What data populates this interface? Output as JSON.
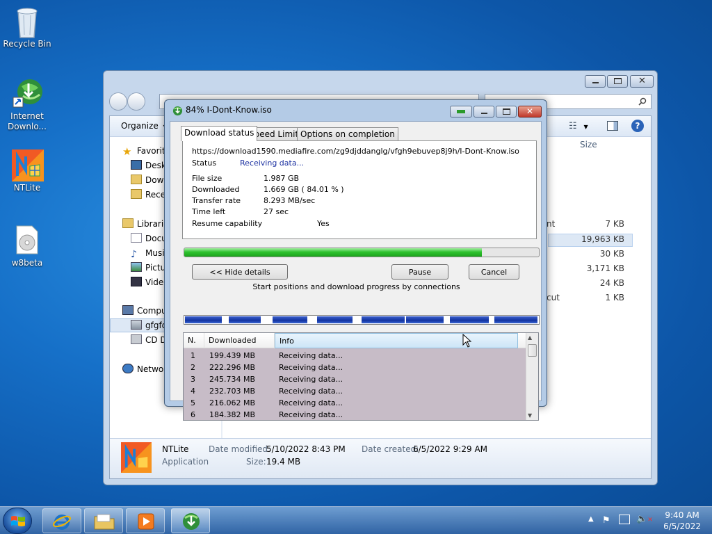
{
  "desktop": {
    "icons": [
      {
        "label": "Recycle Bin"
      },
      {
        "label": "Internet Downlo..."
      },
      {
        "label": "NTLite"
      },
      {
        "label": "w8beta"
      }
    ]
  },
  "explorer": {
    "organize_label": "Organize",
    "size_header": "Size",
    "nav": {
      "favorites": "Favorite",
      "desktop": "Deskt",
      "downloads": "Down",
      "recent": "Recen",
      "libraries": "Librarie",
      "documents": "Docu",
      "music": "Music",
      "pictures": "Pictur",
      "videos": "Video",
      "computer": "Compu",
      "drive": "gfgfd",
      "cd_drive": "CD Dr",
      "network": "Networ"
    },
    "size_rows": [
      {
        "type": "nt",
        "size": "7 KB"
      },
      {
        "type": "",
        "size": "19,963 KB"
      },
      {
        "type": "",
        "size": "30 KB"
      },
      {
        "type": "",
        "size": "3,171 KB"
      },
      {
        "type": "",
        "size": "24 KB"
      },
      {
        "type": "cut",
        "size": "1 KB"
      }
    ],
    "details": {
      "name": "NTLite",
      "kind": "Application",
      "date_modified_label": "Date modified:",
      "date_modified": "5/10/2022 8:43 PM",
      "size_label": "Size:",
      "size": "19.4 MB",
      "date_created_label": "Date created:",
      "date_created": "6/5/2022 9:29 AM"
    }
  },
  "idm": {
    "title": "84% I-Dont-Know.iso",
    "tabs": [
      "Download status",
      "Speed Limiter",
      "Options on completion"
    ],
    "url": "https://download1590.mediafire.com/zg9djddanglg/vfgh9ebuvep8j9h/I-Dont-Know.iso",
    "status_label": "Status",
    "status_value": "Receiving data...",
    "file_size_label": "File size",
    "file_size": "1.987  GB",
    "downloaded_label": "Downloaded",
    "downloaded": "1.669  GB  ( 84.01 % )",
    "transfer_rate_label": "Transfer rate",
    "transfer_rate": "8.293  MB/sec",
    "time_left_label": "Time left",
    "time_left": "27 sec",
    "resume_label": "Resume capability",
    "resume_value": "Yes",
    "progress_fraction": 0.8401,
    "hide_details_label": "<< Hide details",
    "pause_label": "Pause",
    "cancel_label": "Cancel",
    "connections_caption": "Start positions and download progress by connections",
    "columns": [
      "N.",
      "Downloaded",
      "Info"
    ],
    "connections": [
      {
        "n": "1",
        "downloaded": "199.439  MB",
        "info": "Receiving data..."
      },
      {
        "n": "2",
        "downloaded": "222.296  MB",
        "info": "Receiving data..."
      },
      {
        "n": "3",
        "downloaded": "245.734  MB",
        "info": "Receiving data..."
      },
      {
        "n": "4",
        "downloaded": "232.703  MB",
        "info": "Receiving data..."
      },
      {
        "n": "5",
        "downloaded": "216.062  MB",
        "info": "Receiving data..."
      },
      {
        "n": "6",
        "downloaded": "184.382  MB",
        "info": "Receiving data..."
      }
    ]
  },
  "taskbar": {
    "time": "9:40 AM",
    "date": "6/5/2022"
  },
  "colors": {
    "progress_green": "#2ec22e",
    "connection_blue": "#1233a0",
    "status_blue": "#1a2fa0"
  }
}
